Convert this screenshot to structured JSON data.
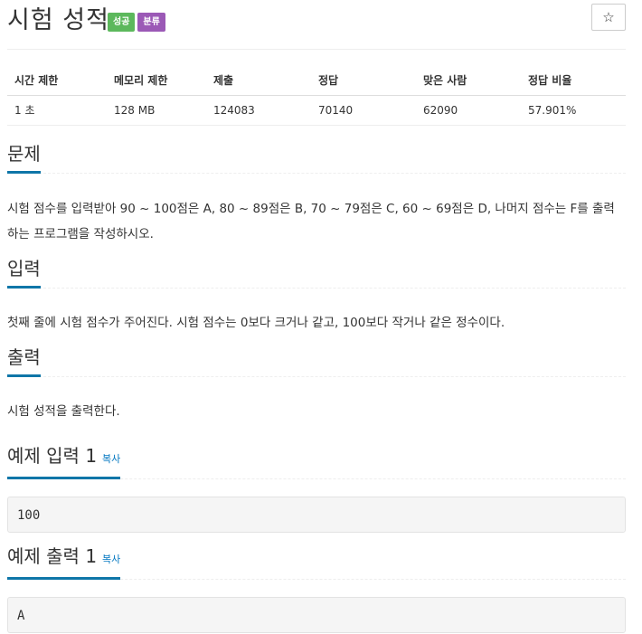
{
  "header": {
    "title": "시험 성적",
    "badges": [
      {
        "label": "성공",
        "color": "#5cb85c"
      },
      {
        "label": "분류",
        "color": "#9b59b6"
      }
    ],
    "star_icon": "☆"
  },
  "info_table": {
    "columns": [
      "시간 제한",
      "메모리 제한",
      "제출",
      "정답",
      "맞은 사람",
      "정답 비율"
    ],
    "row": [
      "1 초",
      "128 MB",
      "124083",
      "70140",
      "62090",
      "57.901%"
    ]
  },
  "problem": {
    "title": "문제",
    "text": "시험 점수를 입력받아 90 ~ 100점은 A, 80 ~ 89점은 B, 70 ~ 79점은 C, 60 ~ 69점은 D, 나머지 점수는 F를 출력하는 프로그램을 작성하시오."
  },
  "input": {
    "title": "입력",
    "text": "첫째 줄에 시험 점수가 주어진다. 시험 점수는 0보다 크거나 같고, 100보다 작거나 같은 정수이다."
  },
  "output": {
    "title": "출력",
    "text": "시험 성적을 출력한다."
  },
  "sample_input": {
    "title": "예제 입력 1",
    "copy_label": "복사",
    "value": "100"
  },
  "sample_output": {
    "title": "예제 출력 1",
    "copy_label": "복사",
    "value": "A"
  },
  "colors": {
    "accent": "#0e76a8",
    "link": "#0076c0"
  }
}
